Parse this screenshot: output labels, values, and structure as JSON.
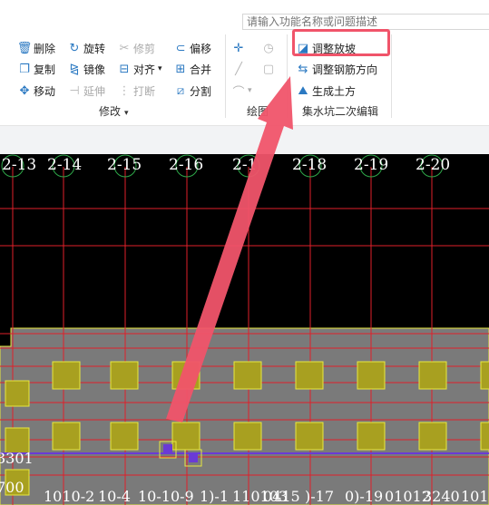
{
  "search": {
    "placeholder": "请输入功能名称或问题描述"
  },
  "modify_group": {
    "label": "修改",
    "tools": {
      "delete": "删除",
      "rotate": "旋转",
      "trim": "修剪",
      "offset": "偏移",
      "copy": "复制",
      "mirror": "镜像",
      "align": "对齐",
      "merge": "合并",
      "move": "移动",
      "extend": "延伸",
      "break": "打断",
      "split": "分割"
    }
  },
  "draw_group": {
    "label": "绘图"
  },
  "sump_group": {
    "label": "集水坑二次编辑",
    "tools": {
      "adjust_slope": "调整放坡",
      "adjust_rebar": "调整钢筋方向",
      "generate_earth": "生成土方"
    }
  },
  "colors": {
    "accent": "#2b79c2",
    "highlight": "#f0546a",
    "grid_line": "#e0202a",
    "column_fill": "#a8a020",
    "column_border": "#e8e840",
    "slab": "#7a7a7a",
    "beam": "#6a3ad6"
  },
  "canvas": {
    "axis_labels": [
      "2-13",
      "2-14",
      "2-15",
      "2-16",
      "2-1",
      "2-18",
      "2-19",
      "2-20"
    ],
    "left_labels": {
      "top": "3301",
      "bottom": "700"
    },
    "bottom_labels": [
      "1010-2",
      "10-4",
      "10-10-9",
      "1)-1",
      "110103",
      "0415",
      ")-17",
      "0)-19",
      "01012",
      "3240",
      "1010"
    ]
  }
}
